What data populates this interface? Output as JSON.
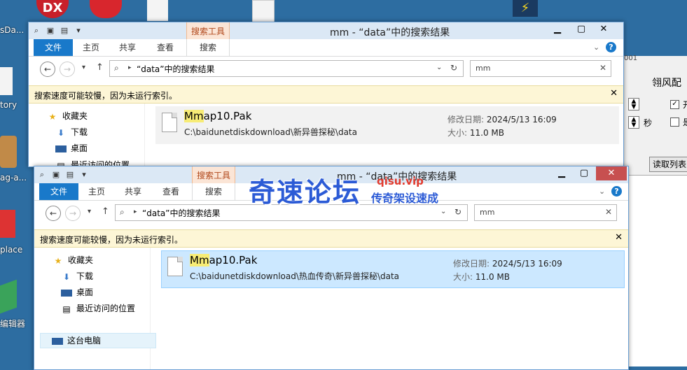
{
  "desktop": {
    "labels": [
      "sDa...",
      "tory",
      "ag-a...",
      "place",
      "编辑器"
    ]
  },
  "bg_app": {
    "title": "翎风配",
    "seconds_label": "秒",
    "check1_text": "开",
    "check2_text": "是",
    "read_list_button": "读取列表",
    "top_text": "001"
  },
  "window_back": {
    "title": "mm - “data”中的搜索结果",
    "context_tab": "搜索工具",
    "tabs": [
      "文件",
      "主页",
      "共享",
      "查看",
      "搜索"
    ],
    "address": "“data”中的搜索结果",
    "search_value": "mm",
    "info": "搜索速度可能较慢，因为未运行索引。",
    "nav": [
      "收藏夹",
      "下载",
      "桌面",
      "最近访问的位置"
    ],
    "result": {
      "name_highlight": "Mm",
      "name_rest": "ap10.Pak",
      "path": "C:\\baidunetdiskdownload\\新异兽探秘\\data",
      "modified_label": "修改日期:",
      "modified": "2024/5/13 16:09",
      "size_label": "大小:",
      "size": "11.0 MB"
    }
  },
  "window_front": {
    "title": "mm - “data”中的搜索结果",
    "context_tab": "搜索工具",
    "tabs": [
      "文件",
      "主页",
      "共享",
      "查看",
      "搜索"
    ],
    "address": "“data”中的搜索结果",
    "search_value": "mm",
    "info": "搜索速度可能较慢，因为未运行索引。",
    "nav": [
      "收藏夹",
      "下载",
      "桌面",
      "最近访问的位置",
      "这台电脑"
    ],
    "result": {
      "name_highlight": "Mm",
      "name_rest": "ap10.Pak",
      "path": "C:\\baidunetdiskdownload\\热血传奇\\新异兽探秘\\data",
      "modified_label": "修改日期:",
      "modified": "2024/5/13 16:09",
      "size_label": "大小:",
      "size": "11.0 MB"
    }
  },
  "watermark": {
    "main": "奇速论坛",
    "url": "qisu.vip",
    "sub": "传奇架设速成"
  },
  "colors": {
    "file_tab": "#1979ca",
    "selection": "#cce8ff",
    "info_bar": "#fdf6d6",
    "close_button": "#c75050"
  }
}
